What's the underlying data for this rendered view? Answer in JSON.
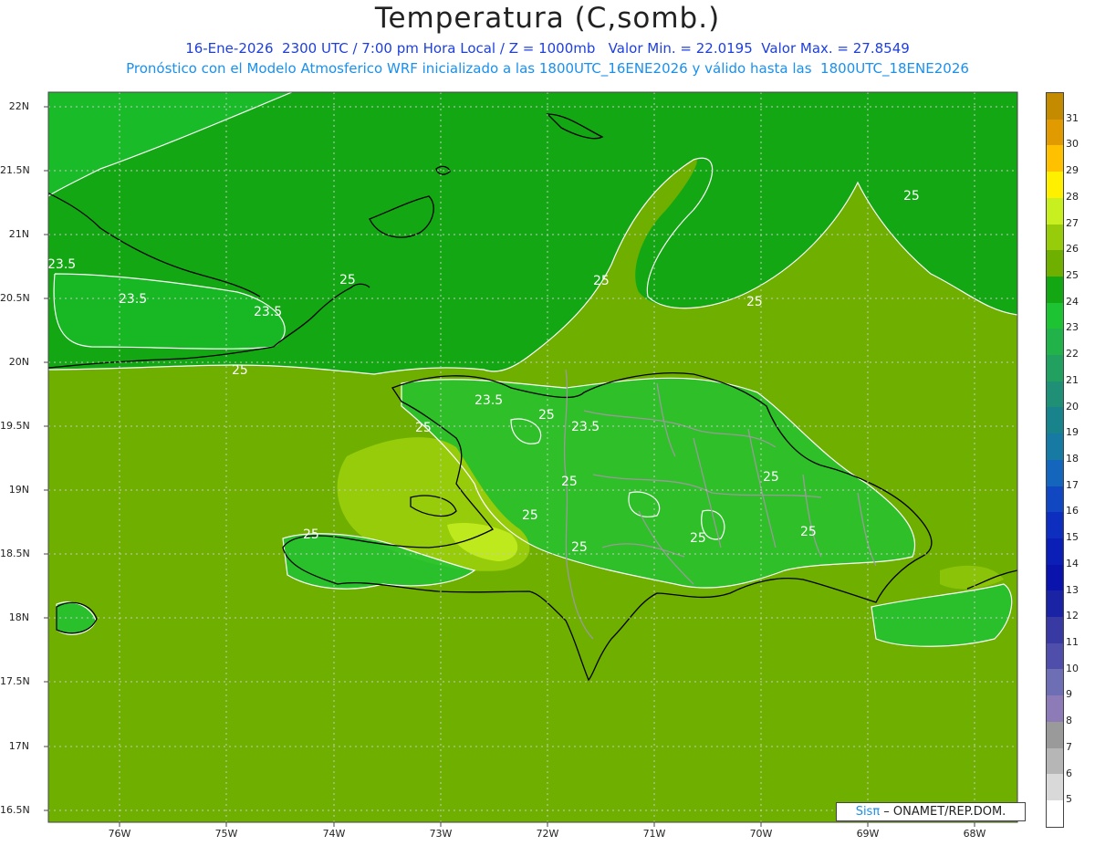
{
  "header": {
    "title": "Temperatura (C,somb.)",
    "line1": "16-Ene-2026  2300 UTC / 7:00 pm Hora Local / Z = 1000mb   Valor Min. = 22.0195  Valor Max. = 27.8549",
    "line2": "Pronóstico con el Modelo Atmosferico WRF inicializado a las 1800UTC_16ENE2026 y válido hasta las  1800UTC_18ENE2026"
  },
  "axes": {
    "lat_labels": [
      "22N",
      "21.5N",
      "21N",
      "20.5N",
      "20N",
      "19.5N",
      "19N",
      "18.5N",
      "18N",
      "17.5N",
      "17N",
      "16.5N"
    ],
    "lon_labels": [
      "76W",
      "75W",
      "74W",
      "73W",
      "72W",
      "71W",
      "70W",
      "69W",
      "68W"
    ]
  },
  "contours": {
    "labels": [
      "23.5",
      "23.5",
      "23.5",
      "25",
      "25",
      "25",
      "25",
      "23.5",
      "25",
      "23.5",
      "25",
      "25",
      "25",
      "25",
      "25",
      "25",
      "25",
      "25",
      "25"
    ]
  },
  "colorbar": {
    "labels": [
      "31",
      "30",
      "29",
      "28",
      "27",
      "26",
      "25",
      "24",
      "23",
      "22",
      "21",
      "20",
      "19",
      "18",
      "17",
      "16",
      "15",
      "14",
      "13",
      "12",
      "11",
      "10",
      "9",
      "8",
      "7",
      "6",
      "5"
    ],
    "colors": [
      "#c48a00",
      "#e19b00",
      "#ffc000",
      "#fff000",
      "#c8f020",
      "#96cc0a",
      "#6eaf00",
      "#13a813",
      "#1ec333",
      "#22b24a",
      "#21a060",
      "#1f9076",
      "#19838c",
      "#167aa2",
      "#1466bd",
      "#1147c0",
      "#0e2ec0",
      "#0b1fb6",
      "#0a14ac",
      "#1923a3",
      "#3939a3",
      "#4f4fab",
      "#6e6eb4",
      "#8c7bb6",
      "#9a9a9a",
      "#b6b6b6",
      "#d9d9d9",
      "#ffffff"
    ]
  },
  "credit": {
    "sis": "Sisπ",
    "rest": " – ONAMET/REP.DOM."
  },
  "legend_colors": {
    "background": "#6eaf00",
    "ocean_north": "#13a813",
    "contour_white": "#ffffff",
    "coast": "#000000",
    "province": "#9a9a9a"
  }
}
